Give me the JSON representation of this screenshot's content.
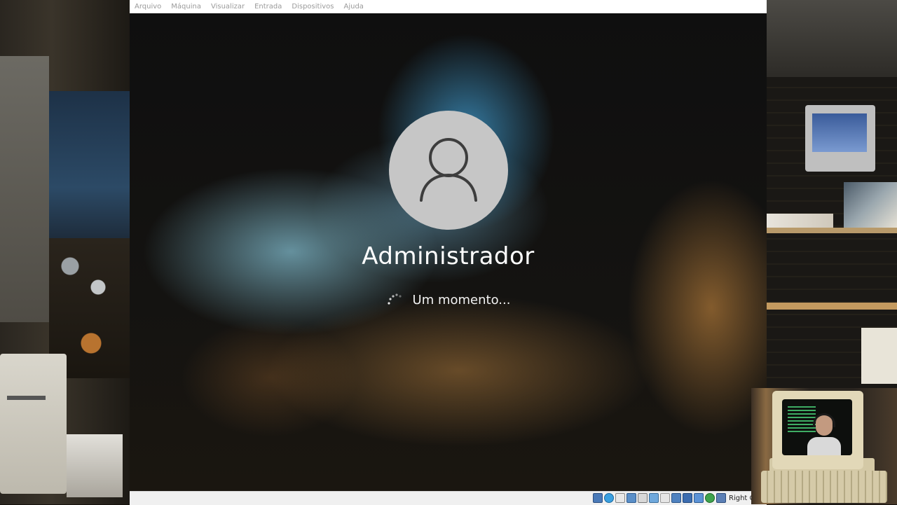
{
  "menubar": {
    "items": [
      "Arquivo",
      "Máquina",
      "Visualizar",
      "Entrada",
      "Dispositivos",
      "Ajuda"
    ]
  },
  "login": {
    "username": "Administrador",
    "status_text": "Um momento..."
  },
  "statusbar": {
    "icons": [
      "hard-disk-icon",
      "optical-drive-icon",
      "audio-icon",
      "network-icon",
      "usb-icon",
      "shared-folder-icon",
      "display-icon",
      "video-capture-icon",
      "recording-icon",
      "cpu-icon",
      "mouse-integration-icon",
      "keyboard-icon"
    ],
    "host_key_label": "Right Control"
  },
  "colors": {
    "menu_text": "#9a9a9a",
    "avatar_bg": "#c6c6c6",
    "avatar_glyph": "#3d3d3d",
    "statusbar_bg": "#f0f0f0"
  }
}
